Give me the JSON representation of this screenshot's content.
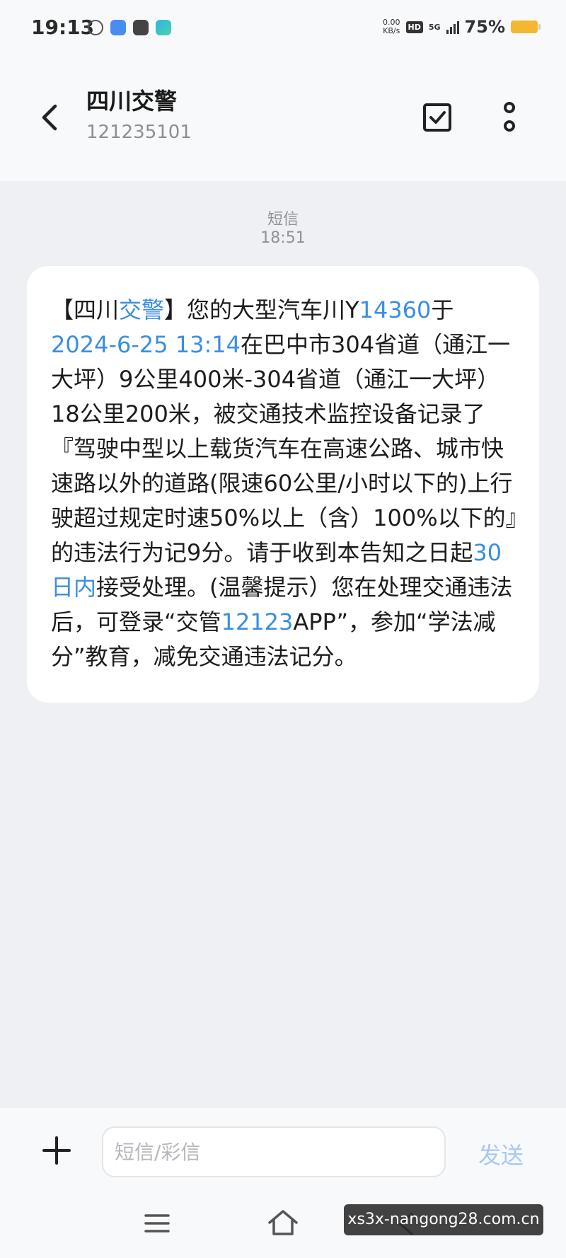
{
  "status_bar": {
    "time": "19:13",
    "net_speed_value": "0.00",
    "net_speed_unit": "KB/s",
    "hd_badge": "HD",
    "network": "5G",
    "battery_percent": "75%",
    "battery_color": "#f5b731"
  },
  "header": {
    "sender_name": "四川交警",
    "sender_number": "121235101",
    "icons": [
      "back-arrow-icon",
      "checkbox-icon",
      "more-vertical-icon"
    ]
  },
  "message": {
    "type_label": "短信",
    "time": "18:51",
    "parts": [
      {
        "text": "【四川"
      },
      {
        "text": "交警",
        "link": true
      },
      {
        "text": "】您的大型汽车川Y"
      },
      {
        "text": "14360",
        "link": true
      },
      {
        "text": "于"
      },
      {
        "text": "2024-6-25 13:14",
        "link": true
      },
      {
        "text": "在巴中市304省道（通江一大坪）9公里400米-304省道（通江一大坪）18公里200米，被交通技术监控设备记录了『驾驶中型以上载货汽车在高速公路、城市快速路以外的道路(限速60公里/小时以下的)上行驶超过规定时速50%以上（含）100%以下的』的违法行为记9分。请于收到本告知之日起"
      },
      {
        "text": "30日内",
        "link": true
      },
      {
        "text": "接受处理。(温馨提示）您在处理交通违法后，可登录“交管"
      },
      {
        "text": "12123",
        "link": true
      },
      {
        "text": "APP”，参加“学法减分”教育，减免交通违法记分。"
      }
    ],
    "link_color": "#3a8ee0"
  },
  "composer": {
    "placeholder": "短信/彩信",
    "send_label": "发送",
    "send_color": "#a9c9ee"
  },
  "watermark": "xs3x-nangong28.com.cn"
}
